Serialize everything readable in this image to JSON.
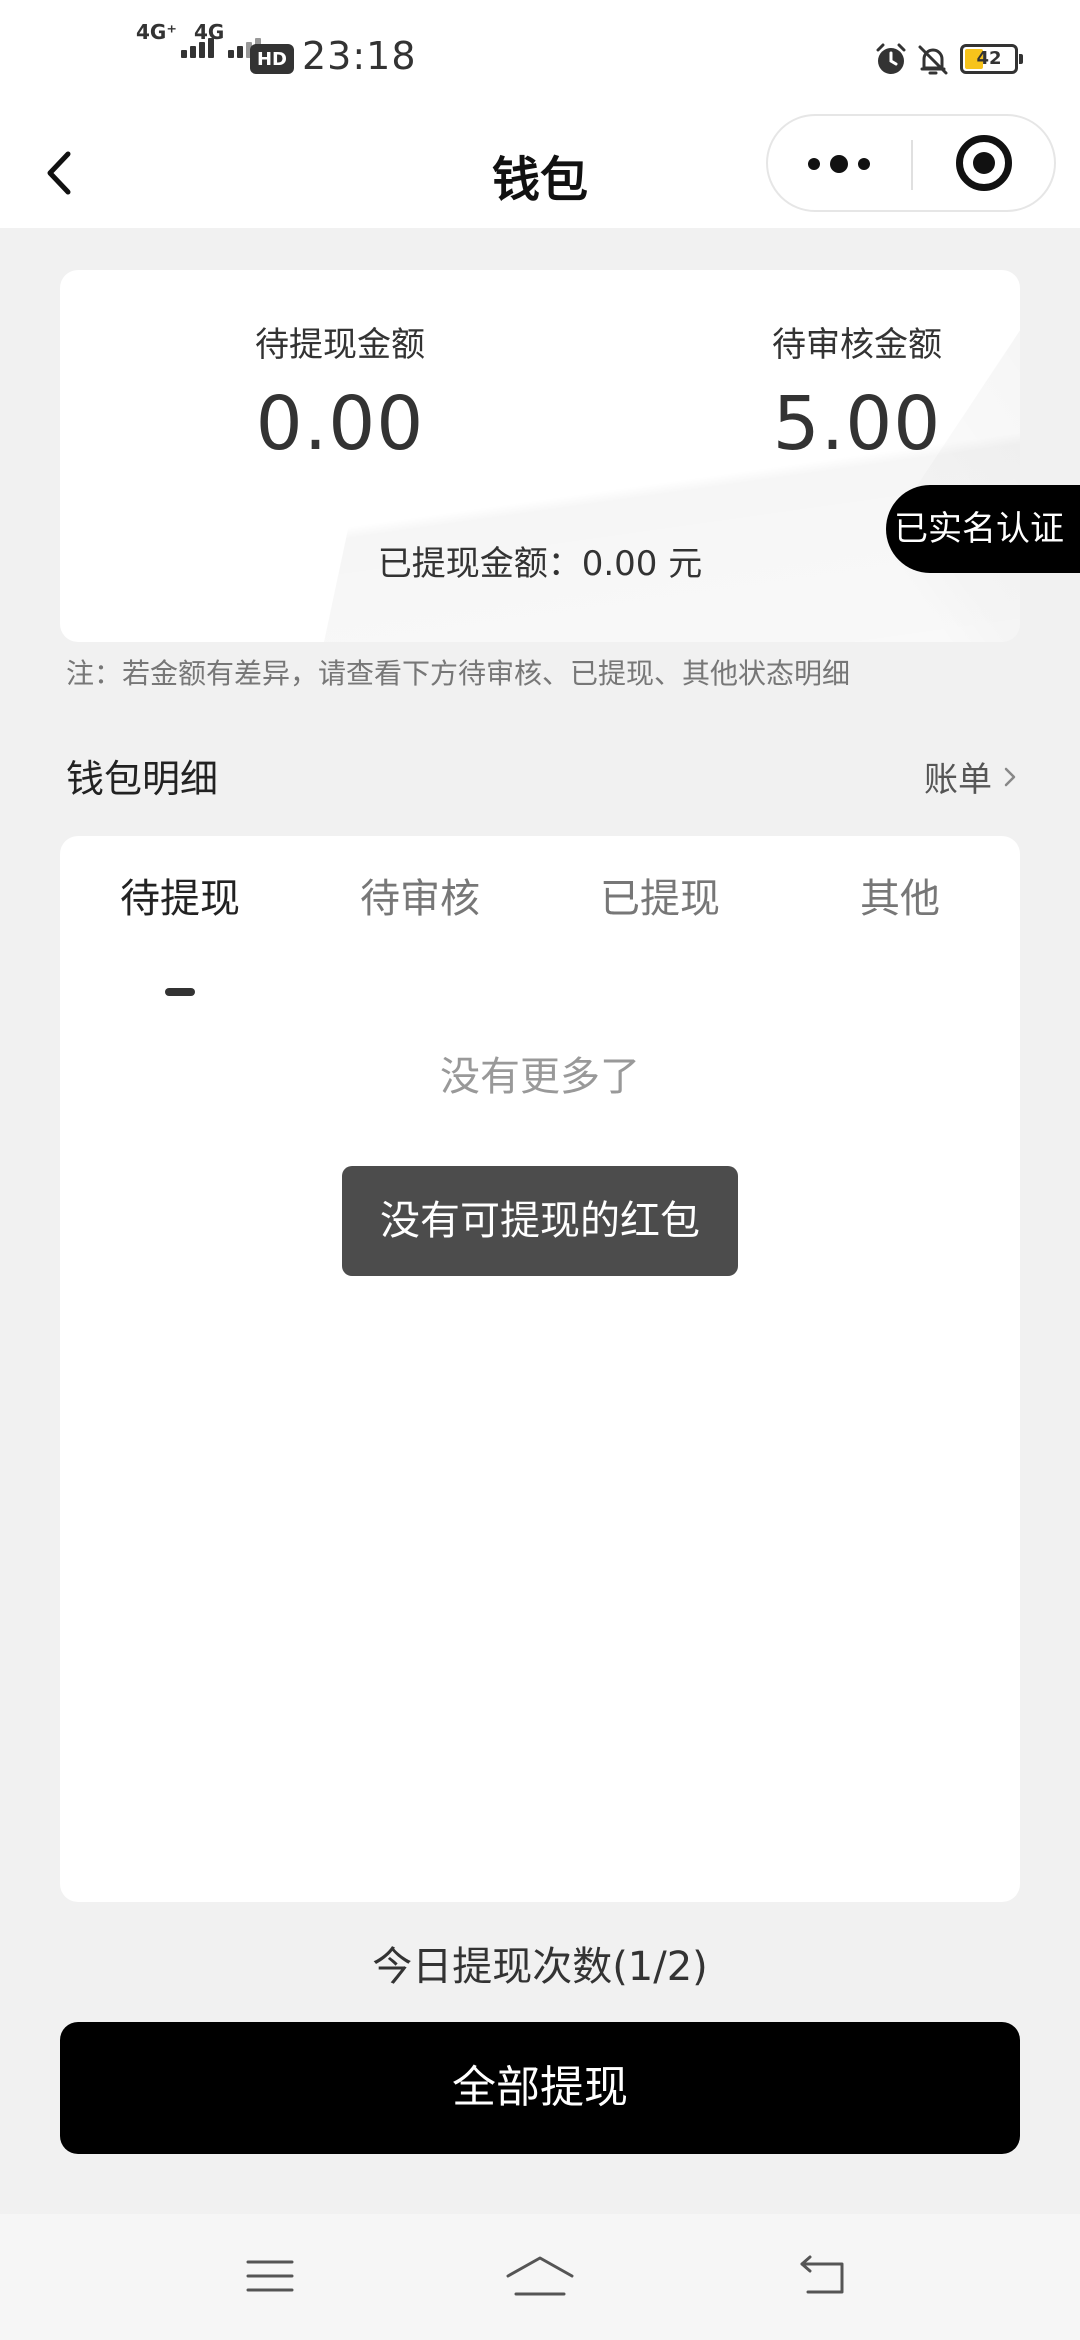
{
  "status_bar": {
    "sim1": "4G⁺",
    "sim2": "4G",
    "hd": "HD",
    "time": "23:18",
    "battery": "42",
    "battery_level": 0.42,
    "battery_color": "#f7c31b",
    "icons": [
      "signal-icon",
      "hd-icon",
      "alarm-icon",
      "bell-off-icon",
      "battery-icon"
    ]
  },
  "nav": {
    "title": "钱包",
    "back_icon": "chevron-left-icon",
    "more_icon": "more-dots-icon",
    "close_icon": "target-close-icon"
  },
  "summary": {
    "pending_withdraw_label": "待提现金额",
    "pending_withdraw_value": "0.00",
    "pending_review_label": "待审核金额",
    "pending_review_value": "5.00",
    "withdrawn_line": "已提现金额：0.00 元"
  },
  "verified_badge": "已实名认证",
  "note": "注：若金额有差异，请查看下方待审核、已提现、其他状态明细",
  "details": {
    "section_title": "钱包明细",
    "bill_link": "账单",
    "tabs": [
      {
        "label": "待提现",
        "active": true
      },
      {
        "label": "待审核",
        "active": false
      },
      {
        "label": "已提现",
        "active": false
      },
      {
        "label": "其他",
        "active": false
      }
    ],
    "empty_text": "没有更多了"
  },
  "toast": "没有可提现的红包",
  "today_count": "今日提现次数(1/2)",
  "withdraw_all_button": "全部提现",
  "system_nav": {
    "icons": [
      "menu-icon",
      "home-icon",
      "back-icon"
    ]
  },
  "colors": {
    "accent": "#000000",
    "page_bg": "#f1f1f1",
    "card_bg": "#ffffff",
    "toast_bg": "#4c4c4c"
  }
}
